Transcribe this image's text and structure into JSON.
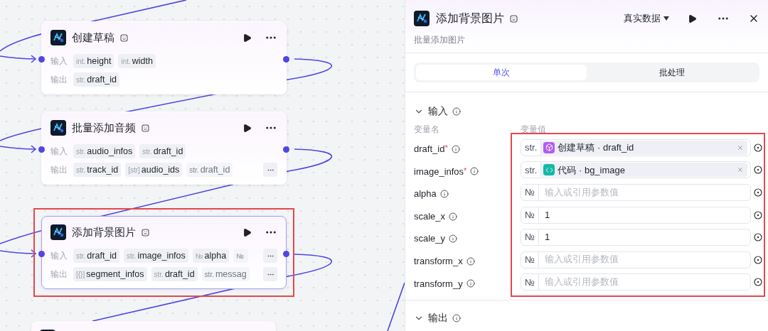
{
  "canvas": {
    "nodes": [
      {
        "kind": "full",
        "title": "创建草稿",
        "selected": false,
        "highlighted": false,
        "input_label": "输入",
        "output_label": "输出",
        "inputs": [
          {
            "type": "int.",
            "name": "height"
          },
          {
            "type": "int.",
            "name": "width"
          }
        ],
        "outputs": [
          {
            "type": "str.",
            "name": "draft_id"
          }
        ],
        "more_inputs": false,
        "more_outputs": false
      },
      {
        "kind": "full",
        "title": "批量添加音频",
        "selected": false,
        "highlighted": false,
        "input_label": "输入",
        "output_label": "输出",
        "inputs": [
          {
            "type": "str.",
            "name": "audio_infos"
          },
          {
            "type": "str.",
            "name": "draft_id"
          }
        ],
        "outputs": [
          {
            "type": "str.",
            "name": "track_id"
          },
          {
            "type": "[str]",
            "name": "audio_ids"
          },
          {
            "type": "str.",
            "name": "draft_id",
            "faded": true
          }
        ],
        "more_inputs": false,
        "more_outputs": true
      },
      {
        "kind": "full",
        "title": "添加背景图片",
        "selected": true,
        "highlighted": true,
        "input_label": "输入",
        "output_label": "输出",
        "inputs": [
          {
            "type": "str.",
            "name": "draft_id"
          },
          {
            "type": "str.",
            "name": "image_infos"
          },
          {
            "type": "№",
            "name": "alpha"
          },
          {
            "type": "№",
            "faded": true
          }
        ],
        "outputs": [
          {
            "type": "[{}]",
            "name": "segment_infos"
          },
          {
            "type": "str.",
            "name": "draft_id"
          },
          {
            "type": "str.",
            "name": "messag",
            "faded": true
          }
        ],
        "more_inputs": true,
        "more_outputs": true
      },
      {
        "kind": "clipped"
      }
    ]
  },
  "panel": {
    "title": "添加背景图片",
    "subtitle": "批量添加图片",
    "data_source": "真实数据",
    "tabs": [
      {
        "label": "单次",
        "selected": true
      },
      {
        "label": "批处理",
        "selected": false
      }
    ],
    "input_section": {
      "title": "输入",
      "expanded": true,
      "column_name": "变量名",
      "column_value": "变量值",
      "highlighted": true,
      "params": [
        {
          "name": "draft_id",
          "required_mark": "*",
          "type": "str.",
          "kind": "reference",
          "ref": {
            "kind": "node",
            "color": "#b45cf0",
            "text": "创建草稿 · draft_id"
          }
        },
        {
          "name": "image_infos",
          "required_mark": "*",
          "type": "str.",
          "kind": "reference",
          "ref": {
            "kind": "code",
            "color": "#14b8a6",
            "text": "代码 · bg_image"
          }
        },
        {
          "name": "alpha",
          "type": "№",
          "kind": "empty",
          "placeholder": "输入或引用参数值"
        },
        {
          "name": "scale_x",
          "type": "№",
          "kind": "value",
          "value": "1"
        },
        {
          "name": "scale_y",
          "type": "№",
          "kind": "value",
          "value": "1"
        },
        {
          "name": "transform_x",
          "type": "№",
          "kind": "empty",
          "placeholder": "输入或引用参数值"
        },
        {
          "name": "transform_y",
          "type": "№",
          "kind": "empty",
          "placeholder": "输入或引用参数值"
        }
      ]
    },
    "output_section": {
      "title": "输出",
      "expanded": true
    }
  }
}
